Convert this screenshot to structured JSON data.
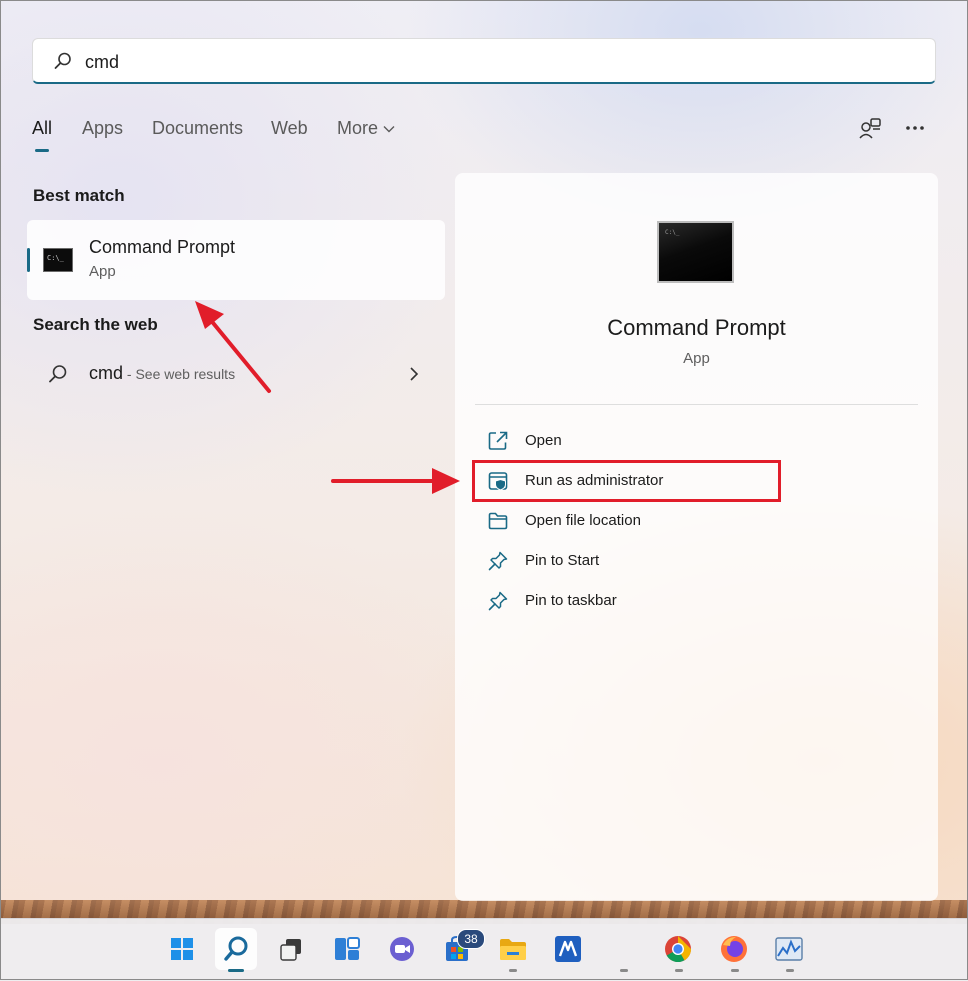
{
  "search": {
    "value": "cmd",
    "placeholder": ""
  },
  "tabs": [
    {
      "label": "All",
      "active": true
    },
    {
      "label": "Apps"
    },
    {
      "label": "Documents"
    },
    {
      "label": "Web"
    },
    {
      "label": "More"
    }
  ],
  "top_icons": [
    "account-switch-icon",
    "more-options-icon"
  ],
  "best_match": {
    "heading": "Best match",
    "title": "Command Prompt",
    "subtitle": "App",
    "icon": "command-prompt-icon"
  },
  "search_web": {
    "heading": "Search the web",
    "query": "cmd",
    "hint": " - See web results"
  },
  "preview": {
    "title": "Command Prompt",
    "subtitle": "App",
    "actions": [
      {
        "label": "Open",
        "icon": "open-external-icon"
      },
      {
        "label": "Run as administrator",
        "icon": "shield-admin-icon"
      },
      {
        "label": "Open file location",
        "icon": "folder-icon"
      },
      {
        "label": "Pin to Start",
        "icon": "pin-icon"
      },
      {
        "label": "Pin to taskbar",
        "icon": "pin-icon"
      }
    ]
  },
  "taskbar": {
    "items": [
      {
        "name": "start-icon"
      },
      {
        "name": "search-icon",
        "active": true
      },
      {
        "name": "task-view-icon"
      },
      {
        "name": "widgets-icon"
      },
      {
        "name": "teams-chat-icon"
      },
      {
        "name": "store-icon",
        "badge": "38"
      },
      {
        "name": "file-explorer-icon"
      },
      {
        "name": "app-icon"
      },
      {
        "name": "chrome-icon"
      },
      {
        "name": "firefox-icon"
      },
      {
        "name": "performance-monitor-icon"
      }
    ]
  },
  "colors": {
    "accent": "#1a6a86",
    "annotation": "#e11d2a"
  }
}
